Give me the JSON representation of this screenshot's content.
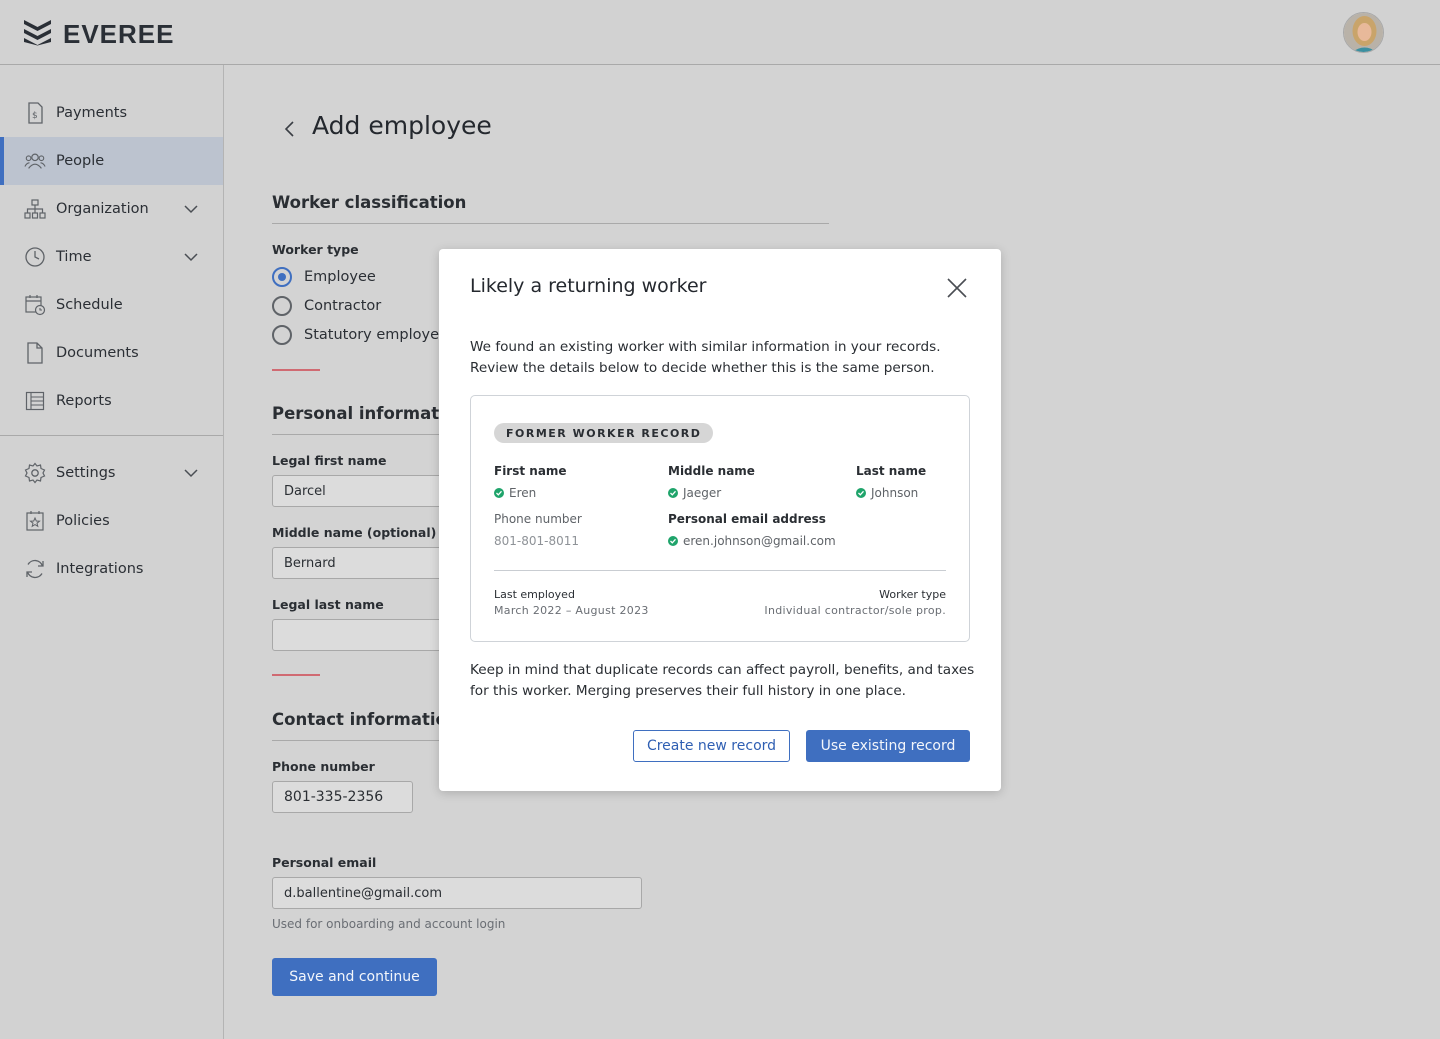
{
  "app": {
    "logo_text": "EVEREE"
  },
  "sidebar": {
    "items": [
      {
        "label": "Payments"
      },
      {
        "label": "People"
      },
      {
        "label": "Organization"
      },
      {
        "label": "Time"
      },
      {
        "label": "Schedule"
      },
      {
        "label": "Documents"
      },
      {
        "label": "Reports"
      },
      {
        "label": "Settings"
      },
      {
        "label": "Policies"
      },
      {
        "label": "Integrations"
      }
    ]
  },
  "page": {
    "title": "Add employee",
    "worker_classification": {
      "title": "Worker classification",
      "worker_type_label": "Worker type",
      "options": [
        "Employee",
        "Contractor",
        "Statutory employee"
      ],
      "selected": "Employee"
    },
    "personal_information": {
      "title": "Personal information",
      "first_name_label": "Legal first name",
      "first_name_value": "Darcel",
      "middle_name_label": "Middle name (optional)",
      "middle_name_value": "Bernard",
      "last_name_label": "Legal last name",
      "last_name_value": ""
    },
    "contact_information": {
      "title": "Contact information",
      "phone_label": "Phone number",
      "phone_value": "801-335-2356",
      "email_label": "Personal email",
      "email_value": "d.ballentine@gmail.com",
      "email_helper": "Used for onboarding and account login"
    },
    "save_label": "Save and continue"
  },
  "modal": {
    "title": "Likely a returning worker",
    "intro": "We found an existing worker with similar information in your records. Review the details below to decide whether this is the same person.",
    "record": {
      "tag": "FORMER WORKER RECORD",
      "first_name_label": "First name",
      "first_name": "Eren",
      "middle_name_label": "Middle name",
      "middle_name": "Jaeger",
      "last_name_label": "Last name",
      "last_name": "Johnson",
      "phone_label": "Phone number",
      "phone": "801-801-8011",
      "email_label": "Personal email address",
      "email": "eren.johnson@gmail.com",
      "last_employed_label": "Last employed",
      "last_employed": "March 2022 – August 2023",
      "worker_type_label": "Worker type",
      "worker_type": "Individual contractor/sole prop."
    },
    "warning": "Keep in mind that duplicate records can affect payroll, benefits, and taxes for this worker. Merging preserves their full history in one place.",
    "create_label": "Create new record",
    "use_existing_label": "Use existing record"
  },
  "colors": {
    "accent": "#3f6fc0",
    "match_check": "#1fa46b",
    "section_underline": "#d06a72"
  }
}
